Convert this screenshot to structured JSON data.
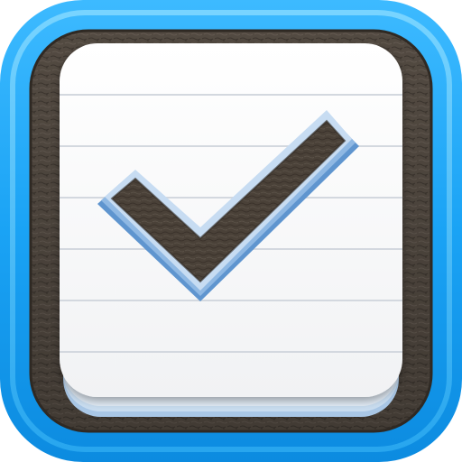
{
  "app_icon": {
    "name": "checklist-app-icon",
    "icon": "checkmark-notepad-icon",
    "colors": {
      "frame_blue": "#1aa3f5",
      "frame_blue_light": "#46c3ff",
      "frame_blue_dark": "#0b7fd0",
      "leather": "#5a5148",
      "leather_dark": "#3a332c",
      "paper": "#f8f8f8",
      "paper_edge": "#b9d3ea",
      "rule_line": "#d6dbe2",
      "check_fill": "#4b4239",
      "check_edge_blue": "#6ea3d6"
    }
  }
}
